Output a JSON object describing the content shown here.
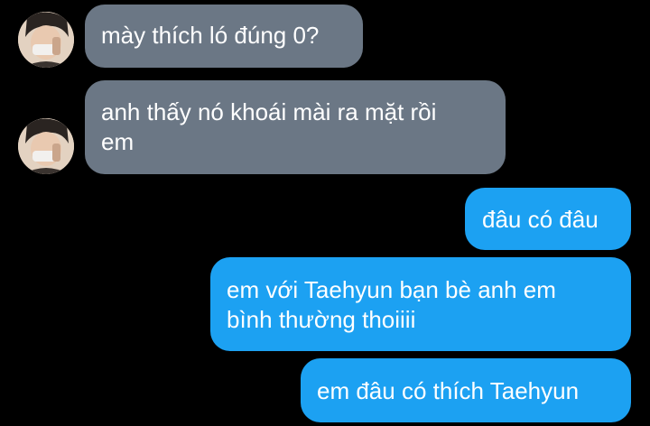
{
  "conversation": {
    "messages": [
      {
        "sender": "incoming",
        "avatar": "sender-avatar",
        "lines": [
          "mày thích ló đúng 0?"
        ]
      },
      {
        "sender": "incoming",
        "avatar": "sender-avatar",
        "lines": [
          "anh thấy nó khoái mài ra mặt rồi",
          "em"
        ]
      },
      {
        "sender": "outgoing",
        "lines": [
          "đâu có đâu"
        ]
      },
      {
        "sender": "outgoing",
        "lines": [
          "em với Taehyun bạn bè anh em",
          "bình thường thoiiii"
        ]
      },
      {
        "sender": "outgoing",
        "lines": [
          "em đâu có thích Taehyun"
        ]
      }
    ]
  },
  "colors": {
    "background": "#000000",
    "incoming_bubble": "#6b7785",
    "outgoing_bubble": "#1ca1f2",
    "text": "#ffffff"
  }
}
